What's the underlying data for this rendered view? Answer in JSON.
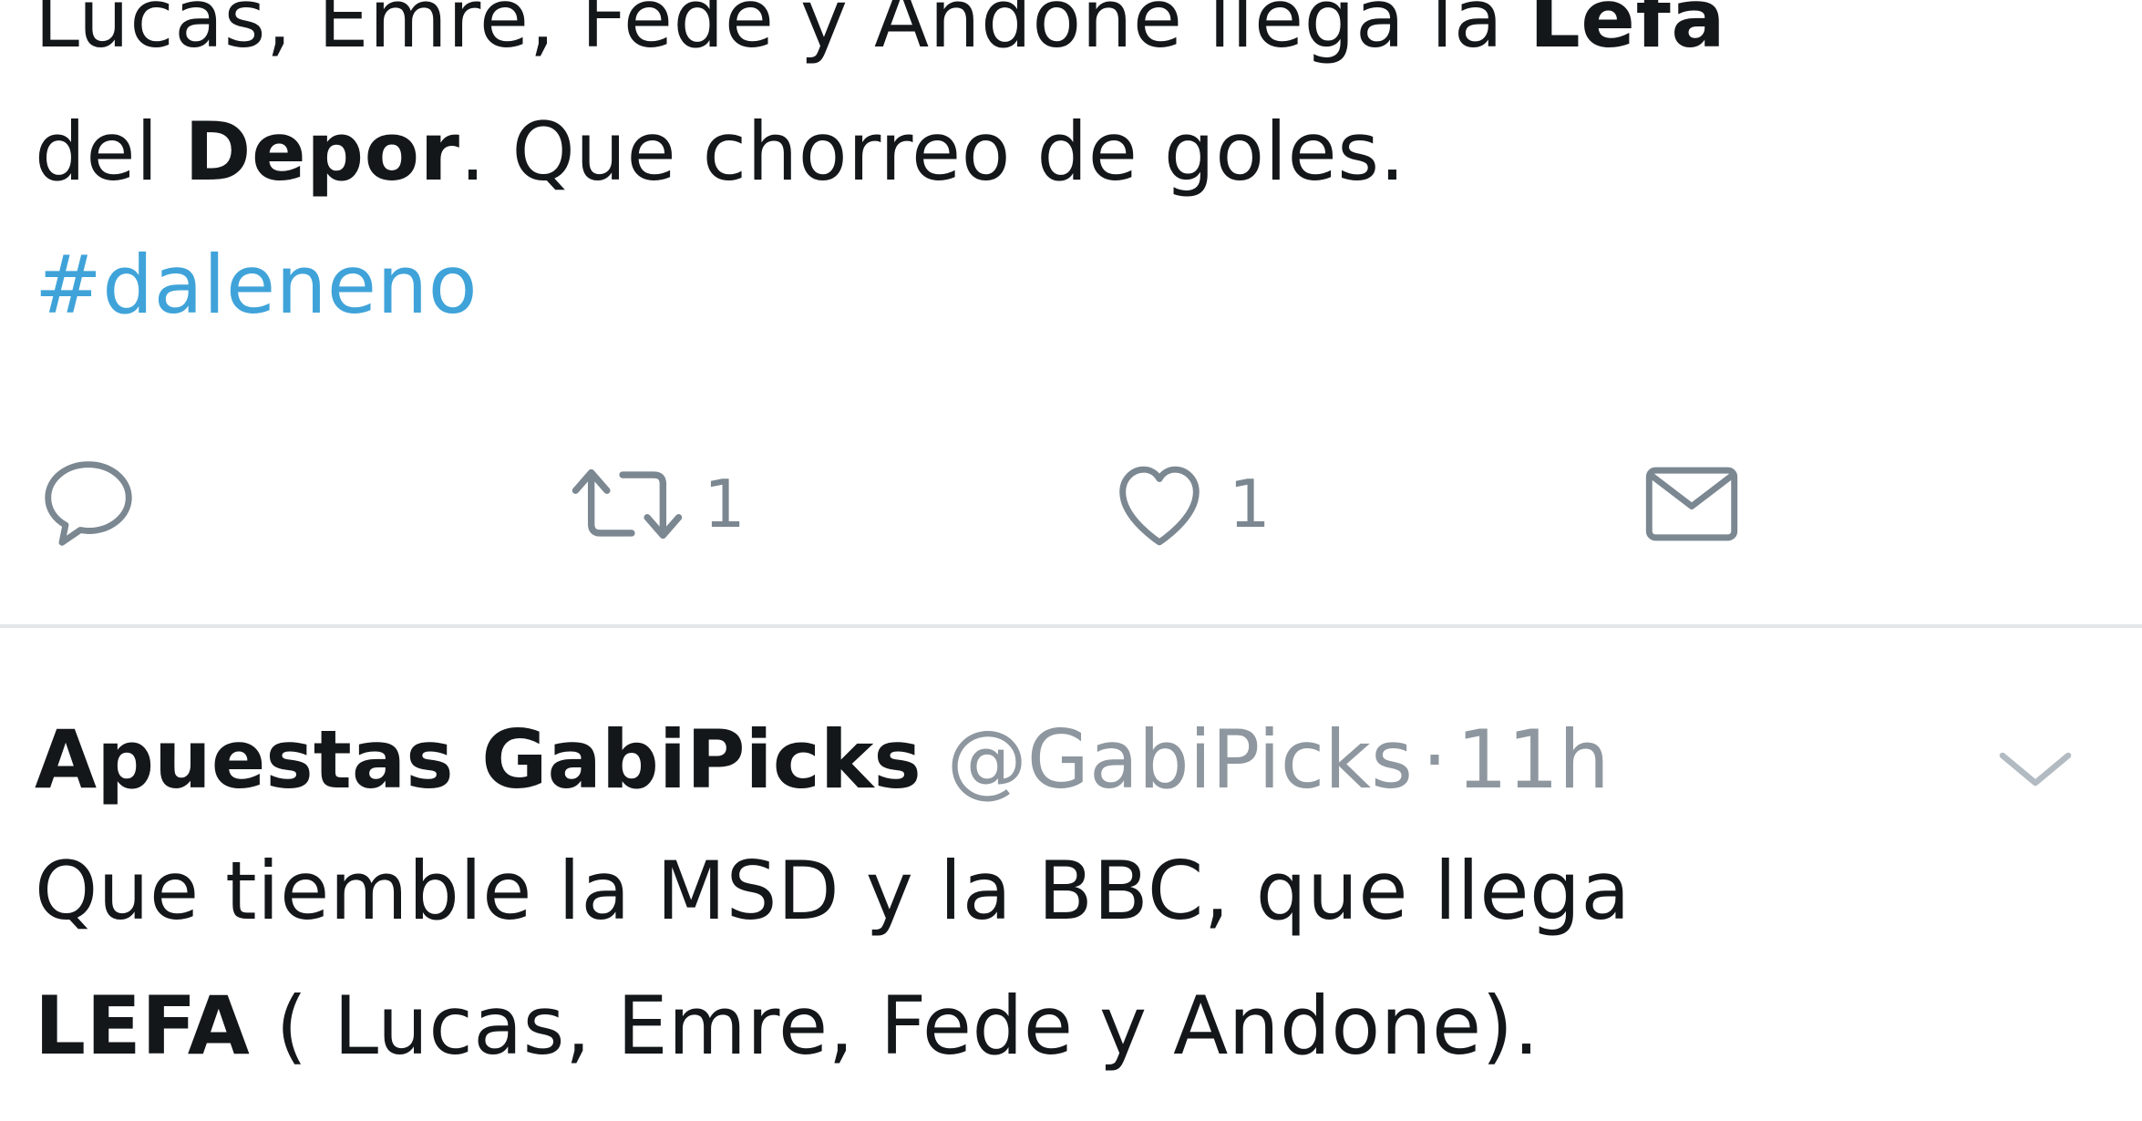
{
  "tweet1": {
    "line1_a": "Lucas, Emre, Fede y Andone llega la ",
    "line1_b": "Lefa",
    "line2_a": "del ",
    "line2_b": "Depor",
    "line2_c": ". Que chorreo de goles.",
    "hashtag": "#daleneno",
    "actions": {
      "reply_count": "",
      "retweet_count": "1",
      "like_count": "1"
    }
  },
  "tweet2": {
    "author_name": "Apuestas GabiPicks",
    "author_handle": "@GabiPicks",
    "separator": "·",
    "timestamp": "11h",
    "line1": "Que tiemble la MSD y la BBC, que llega",
    "line2_a": "LEFA",
    "line2_b": " ( Lucas, Emre, Fede y Andone)."
  },
  "colors": {
    "hashtag": "#3fa3d9",
    "icon_gray": "#7b8791",
    "divider": "#e3e7ea"
  },
  "icons": [
    "reply-icon",
    "retweet-icon",
    "like-icon",
    "direct-message-icon",
    "chevron-down-icon"
  ]
}
